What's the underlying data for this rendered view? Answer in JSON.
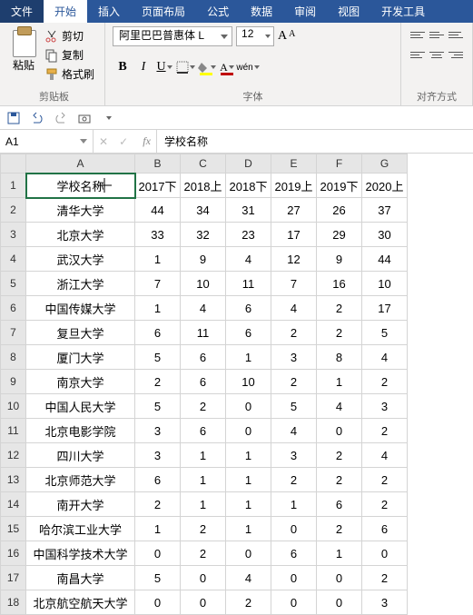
{
  "tabs": {
    "file": "文件",
    "home": "开始",
    "insert": "插入",
    "layout": "页面布局",
    "formulas": "公式",
    "data": "数据",
    "review": "审阅",
    "view": "视图",
    "dev": "开发工具"
  },
  "clipboard": {
    "cut": "剪切",
    "copy": "复制",
    "format": "格式刷",
    "paste": "粘贴",
    "group": "剪贴板"
  },
  "font": {
    "name": "阿里巴巴普惠体 L",
    "size": "12",
    "group": "字体"
  },
  "align": {
    "group": "对齐方式"
  },
  "cellref": "A1",
  "formula": "学校名称",
  "columns": [
    "A",
    "B",
    "C",
    "D",
    "E",
    "F",
    "G"
  ],
  "headerRow": [
    "学校名称",
    "2017下",
    "2018上",
    "2018下",
    "2019上",
    "2019下",
    "2020上"
  ],
  "rows": [
    [
      "清华大学",
      "44",
      "34",
      "31",
      "27",
      "26",
      "37"
    ],
    [
      "北京大学",
      "33",
      "32",
      "23",
      "17",
      "29",
      "30"
    ],
    [
      "武汉大学",
      "1",
      "9",
      "4",
      "12",
      "9",
      "44"
    ],
    [
      "浙江大学",
      "7",
      "10",
      "11",
      "7",
      "16",
      "10"
    ],
    [
      "中国传媒大学",
      "1",
      "4",
      "6",
      "4",
      "2",
      "17"
    ],
    [
      "复旦大学",
      "6",
      "11",
      "6",
      "2",
      "2",
      "5"
    ],
    [
      "厦门大学",
      "5",
      "6",
      "1",
      "3",
      "8",
      "4"
    ],
    [
      "南京大学",
      "2",
      "6",
      "10",
      "2",
      "1",
      "2"
    ],
    [
      "中国人民大学",
      "5",
      "2",
      "0",
      "5",
      "4",
      "3"
    ],
    [
      "北京电影学院",
      "3",
      "6",
      "0",
      "4",
      "0",
      "2"
    ],
    [
      "四川大学",
      "3",
      "1",
      "1",
      "3",
      "2",
      "4"
    ],
    [
      "北京师范大学",
      "6",
      "1",
      "1",
      "2",
      "2",
      "2"
    ],
    [
      "南开大学",
      "2",
      "1",
      "1",
      "1",
      "6",
      "2"
    ],
    [
      "哈尔滨工业大学",
      "1",
      "2",
      "1",
      "0",
      "2",
      "6"
    ],
    [
      "中国科学技术大学",
      "0",
      "2",
      "0",
      "6",
      "1",
      "0"
    ],
    [
      "南昌大学",
      "5",
      "0",
      "4",
      "0",
      "0",
      "2"
    ],
    [
      "北京航空航天大学",
      "0",
      "0",
      "2",
      "0",
      "0",
      "3"
    ]
  ]
}
